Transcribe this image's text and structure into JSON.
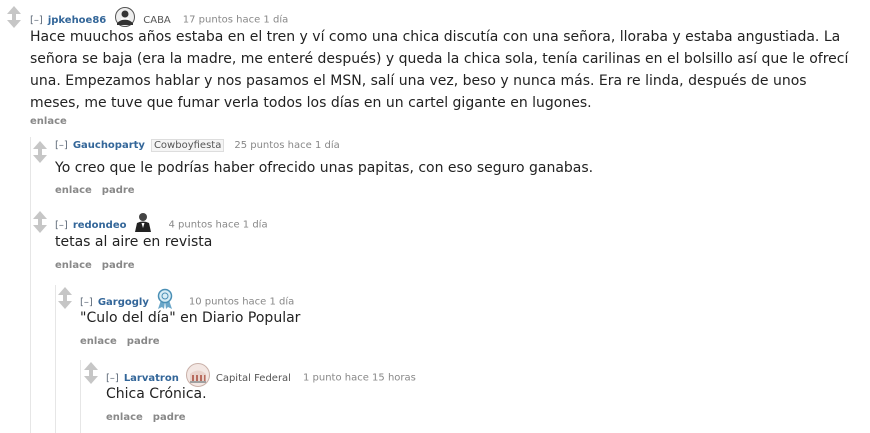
{
  "comments": [
    {
      "collapse": "[–]",
      "author": "jpkehoe86",
      "flair_icon": "scarf-avatar-icon",
      "flair": "CABA",
      "meta": "17 puntos hace 1 día",
      "body": "Hace muuchos años estaba en el tren y ví como una chica discutía con una señora, lloraba y estaba angustiada. La señora se baja (era la madre, me enteré después) y queda la chica sola, tenía carilinas en el bolsillo así que le ofrecí una. Empezamos hablar y nos pasamos el MSN, salí una vez, beso y nunca más. Era re linda, después de unos meses, me tuve que fumar verla todos los días en un cartel gigante en lugones.",
      "actions": [
        "enlace"
      ]
    },
    {
      "collapse": "[–]",
      "author": "Gauchoparty",
      "flair": "Cowboyfiesta",
      "meta": "25 puntos hace 1 día",
      "body": "Yo creo que le podrías haber ofrecido unas papitas, con eso seguro ganabas.",
      "actions": [
        "enlace",
        "padre"
      ]
    },
    {
      "collapse": "[–]",
      "author": "redondeo",
      "flair_icon": "suited-man-icon",
      "meta": "4 puntos hace 1 día",
      "body": "tetas al aire en revista",
      "actions": [
        "enlace",
        "padre"
      ]
    },
    {
      "collapse": "[–]",
      "author": "Gargogly",
      "flair_icon": "ribbon-badge-icon",
      "meta": "10 puntos hace 1 día",
      "body": "\"Culo del día\" en Diario Popular",
      "actions": [
        "enlace",
        "padre"
      ]
    },
    {
      "collapse": "[–]",
      "author": "Larvatron",
      "flair_icon": "building-icon",
      "flair": "Capital Federal",
      "meta": "1 punto hace 15 horas",
      "body": "Chica Crónica.",
      "actions": [
        "enlace",
        "padre"
      ]
    }
  ]
}
